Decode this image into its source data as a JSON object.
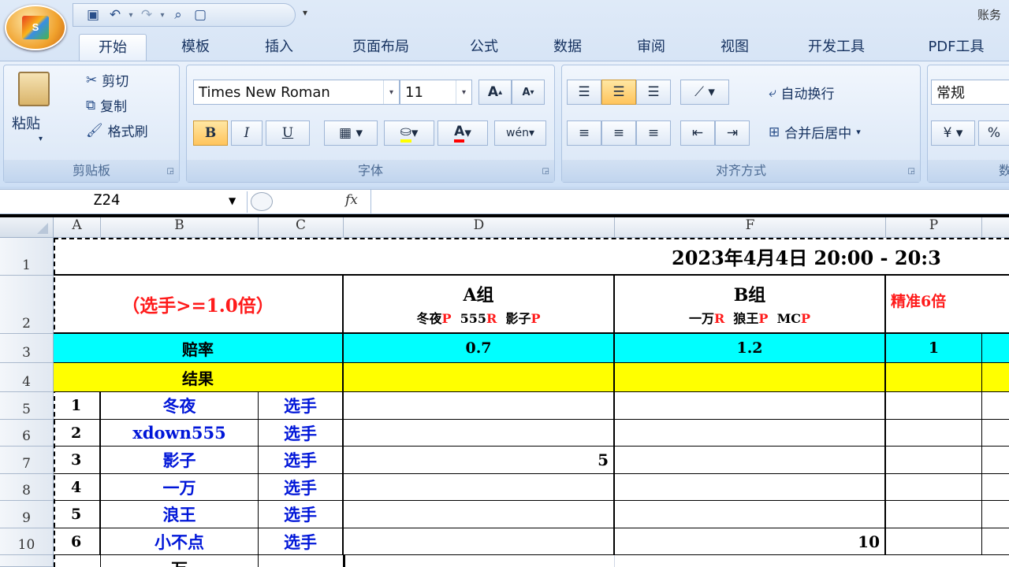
{
  "window": {
    "title": "账务"
  },
  "quick_access": [
    "save-icon",
    "undo-icon",
    "redo-icon",
    "print-preview-icon",
    "new-document-icon"
  ],
  "tabs": [
    {
      "label": "开始",
      "active": true
    },
    {
      "label": "模板"
    },
    {
      "label": "插入"
    },
    {
      "label": "页面布局"
    },
    {
      "label": "公式"
    },
    {
      "label": "数据"
    },
    {
      "label": "审阅"
    },
    {
      "label": "视图"
    },
    {
      "label": "开发工具"
    },
    {
      "label": "PDF工具"
    }
  ],
  "clipboard": {
    "paste": "粘贴",
    "cut": "剪切",
    "copy": "复制",
    "format_painter": "格式刷",
    "caption": "剪贴板"
  },
  "font": {
    "name": "Times New Roman",
    "size": "11",
    "caption": "字体",
    "bold": "B",
    "italic": "I",
    "underline": "U",
    "grow": "A",
    "shrink": "A",
    "phonetic": "wén"
  },
  "align": {
    "wrap": "自动换行",
    "merge": "合并后居中",
    "caption": "对齐方式"
  },
  "number": {
    "format": "常规",
    "caption": "数",
    "percent": "%"
  },
  "formula_bar": {
    "name_box": "Z24",
    "fx": "fx",
    "content": ""
  },
  "columns": [
    "A",
    "B",
    "C",
    "D",
    "F",
    "P"
  ],
  "rows": [
    "1",
    "2",
    "3",
    "4",
    "5",
    "6",
    "7",
    "8",
    "9",
    "10"
  ],
  "sheet": {
    "title": "2023年4月4日 20:00 - 20:3",
    "rule": "（选手>=1.0倍）",
    "group_a": {
      "name": "A组",
      "members": [
        {
          "n": "冬夜",
          "t": "P"
        },
        {
          "n": "555",
          "t": "R"
        },
        {
          "n": "影子",
          "t": "P"
        }
      ]
    },
    "group_b": {
      "name": "B组",
      "members": [
        {
          "n": "一万",
          "t": "R"
        },
        {
          "n": "狼王",
          "t": "P"
        },
        {
          "n": "MC",
          "t": "P"
        }
      ]
    },
    "precise": "精准6倍",
    "odds_label": "赔率",
    "odds": {
      "a": "0.7",
      "b": "1.2",
      "p": "1"
    },
    "result_label": "结果",
    "players": [
      {
        "no": "1",
        "name": "冬夜",
        "role": "选手",
        "d": "",
        "f": ""
      },
      {
        "no": "2",
        "name": "xdown555",
        "role": "选手",
        "d": "",
        "f": ""
      },
      {
        "no": "3",
        "name": "影子",
        "role": "选手",
        "d": "5",
        "f": ""
      },
      {
        "no": "4",
        "name": "一万",
        "role": "选手",
        "d": "",
        "f": ""
      },
      {
        "no": "5",
        "name": "浪王",
        "role": "选手",
        "d": "",
        "f": ""
      },
      {
        "no": "6",
        "name": "小不点",
        "role": "选手",
        "d": "",
        "f": "10"
      }
    ],
    "partial_row": "万"
  }
}
